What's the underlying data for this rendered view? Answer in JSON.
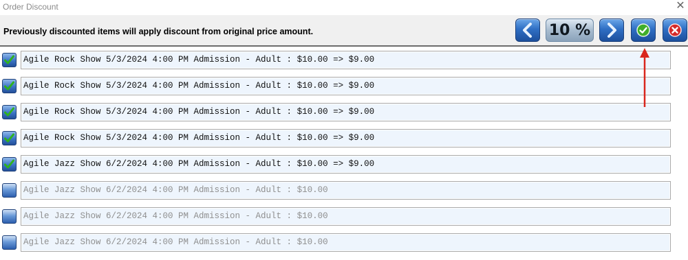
{
  "window": {
    "title": "Order Discount",
    "close_icon": "close-icon"
  },
  "toolbar": {
    "message": "Previously discounted items will apply discount from original price amount.",
    "prev_icon": "chevron-left-icon",
    "percent_label": "10 %",
    "next_icon": "chevron-right-icon",
    "ok_icon": "checkmark-circle-icon",
    "cancel_icon": "close-circle-icon"
  },
  "items": [
    {
      "checked": true,
      "text": "Agile Rock Show 5/3/2024 4:00 PM Admission - Adult : $10.00 => $9.00"
    },
    {
      "checked": true,
      "text": "Agile Rock Show 5/3/2024 4:00 PM Admission - Adult : $10.00 => $9.00"
    },
    {
      "checked": true,
      "text": "Agile Rock Show 5/3/2024 4:00 PM Admission - Adult : $10.00 => $9.00"
    },
    {
      "checked": true,
      "text": "Agile Rock Show 5/3/2024 4:00 PM Admission - Adult : $10.00 => $9.00"
    },
    {
      "checked": true,
      "text": "Agile Jazz Show 6/2/2024 4:00 PM Admission - Adult : $10.00 => $9.00"
    },
    {
      "checked": false,
      "text": "Agile Jazz Show 6/2/2024 4:00 PM Admission - Adult : $10.00"
    },
    {
      "checked": false,
      "text": "Agile Jazz Show 6/2/2024 4:00 PM Admission - Adult : $10.00"
    },
    {
      "checked": false,
      "text": "Agile Jazz Show 6/2/2024 4:00 PM Admission - Adult : $10.00"
    }
  ],
  "colors": {
    "annotation_arrow": "#d9261c",
    "item_background": "#eef5fd",
    "toolbar_background": "#f0f0f0"
  }
}
